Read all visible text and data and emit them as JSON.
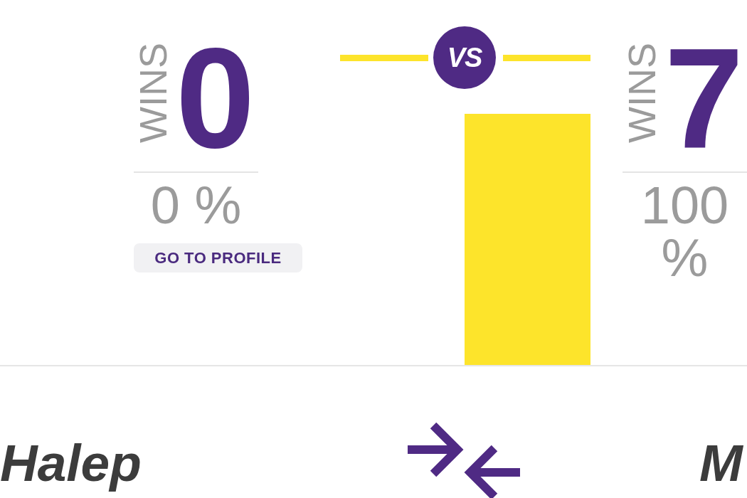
{
  "versus": "VS",
  "players": [
    {
      "wins_label": "WINS",
      "wins": "0",
      "percent": "0 %",
      "profile_button": "GO TO PROFILE",
      "name": "Halep"
    },
    {
      "wins_label": "WINS",
      "wins": "7",
      "percent": "100 %",
      "name": "M"
    }
  ]
}
